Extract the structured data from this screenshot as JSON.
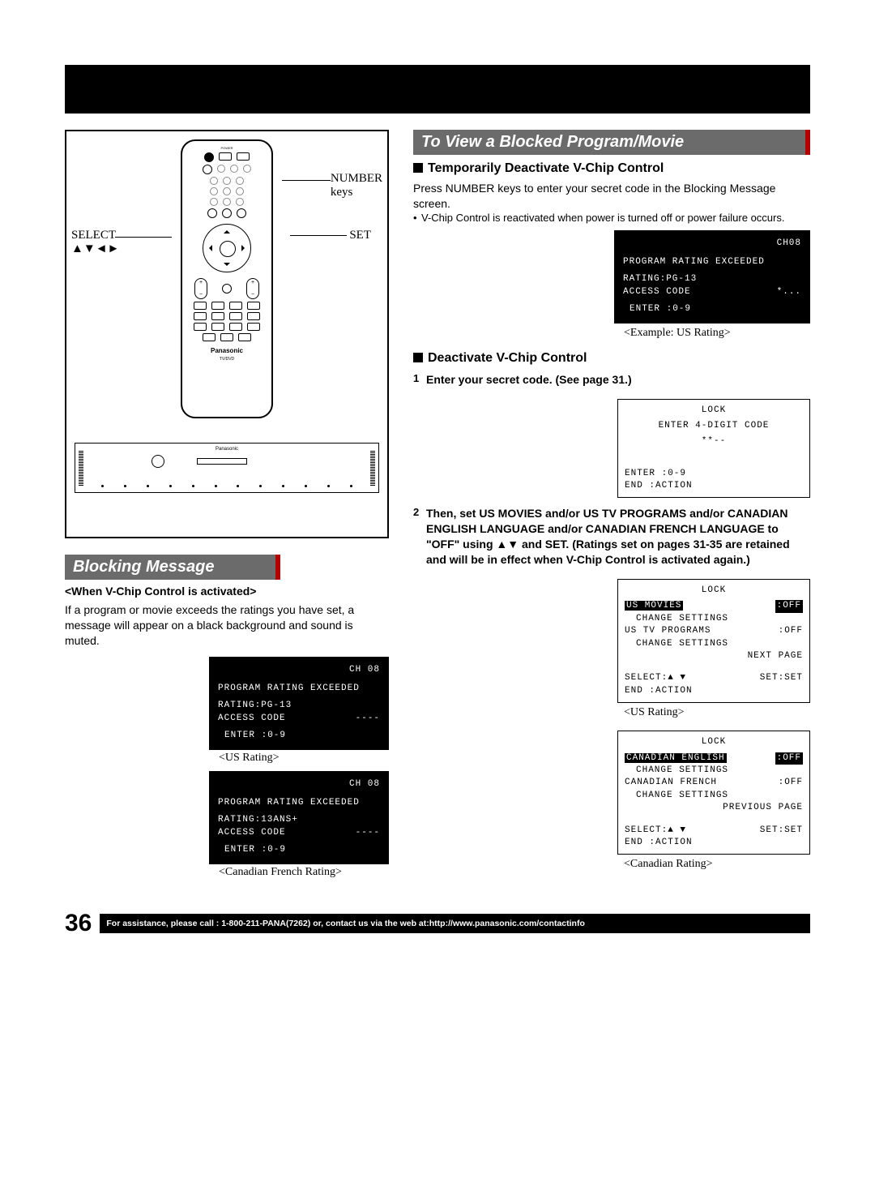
{
  "pageNumber": "36",
  "footer": "For assistance, please call : 1-800-211-PANA(7262) or, contact us via the web at:http://www.panasonic.com/contactinfo",
  "remote": {
    "labels": {
      "number": "NUMBER",
      "keys": "keys",
      "select": "SELECT",
      "selectArrows": "▲▼◄►",
      "set": "SET"
    },
    "brand": "Panasonic",
    "subBrand": "TV/DVD"
  },
  "blockingMessage": {
    "header": "Blocking Message",
    "subhead": "<When V-Chip Control is activated>",
    "body": "If a program or movie exceeds the ratings you have set, a message will appear on a black background and sound is muted.",
    "screenUS": {
      "ch": "CH 08",
      "line1": "PROGRAM RATING EXCEEDED",
      "line2": "RATING:PG-13",
      "line3a": "ACCESS CODE",
      "line3b": "----",
      "line4": "ENTER :0-9"
    },
    "captionUS": "<US Rating>",
    "screenCA": {
      "ch": "CH 08",
      "line1": "PROGRAM RATING EXCEEDED",
      "line2": "RATING:13ANS+",
      "line3a": "ACCESS CODE",
      "line3b": "----",
      "line4": "ENTER :0-9"
    },
    "captionCA": "<Canadian French Rating>"
  },
  "rightCol": {
    "header": "To View a Blocked Program/Movie",
    "section1": {
      "title": "Temporarily Deactivate V-Chip Control",
      "para": "Press NUMBER keys to enter your secret code in the Blocking Message screen.",
      "bullet": "V-Chip Control is reactivated when power is turned off or power failure occurs.",
      "screen": {
        "ch": "CH08",
        "line1": "PROGRAM RATING EXCEEDED",
        "line2": "RATING:PG-13",
        "line3a": "ACCESS CODE",
        "line3b": "*...",
        "line4": "ENTER :0-9"
      },
      "caption": "<Example: US Rating>"
    },
    "section2": {
      "title": "Deactivate V-Chip Control",
      "step1": {
        "num": "1",
        "text": "Enter your secret code. (See page 31.)",
        "screen": {
          "title": "LOCK",
          "line1": "ENTER 4-DIGIT CODE",
          "line2": "**--",
          "footer1": "ENTER :0-9",
          "footer2": "END   :ACTION"
        }
      },
      "step2": {
        "num": "2",
        "text": "Then, set US MOVIES and/or US TV PROGRAMS and/or CANADIAN ENGLISH LANGUAGE and/or CANADIAN FRENCH LANGUAGE to \"OFF\" using ▲▼ and SET. (Ratings set on pages 31-35 are retained and will be in effect when V-Chip Control is activated again.)",
        "screenUS": {
          "title": "LOCK",
          "row1a": "US MOVIES",
          "row1b": ":OFF",
          "row2": "CHANGE SETTINGS",
          "row3a": "US TV PROGRAMS",
          "row3b": ":OFF",
          "row4": "CHANGE SETTINGS",
          "row5": "NEXT PAGE",
          "footer1": "SELECT:▲ ▼",
          "footer1b": "SET:SET",
          "footer2": "END   :ACTION"
        },
        "captionUS": "<US Rating>",
        "screenCA": {
          "title": "LOCK",
          "row1a": "CANADIAN ENGLISH",
          "row1b": ":OFF",
          "row2": "CHANGE SETTINGS",
          "row3a": "CANADIAN FRENCH",
          "row3b": ":OFF",
          "row4": "CHANGE SETTINGS",
          "row5": "PREVIOUS PAGE",
          "footer1": "SELECT:▲ ▼",
          "footer1b": "SET:SET",
          "footer2": "END   :ACTION"
        },
        "captionCA": "<Canadian Rating>"
      }
    }
  }
}
